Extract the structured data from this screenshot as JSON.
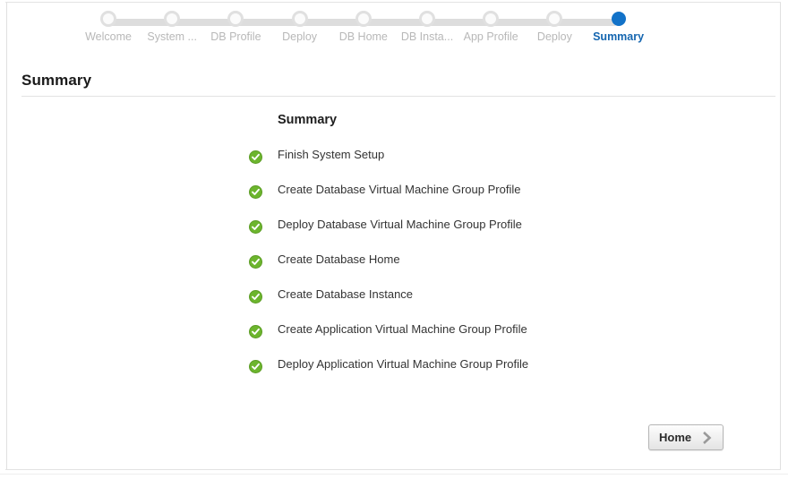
{
  "wizard": {
    "steps": [
      {
        "label": "Welcome",
        "state": "done"
      },
      {
        "label": "System ...",
        "state": "done"
      },
      {
        "label": "DB Profile",
        "state": "done"
      },
      {
        "label": "Deploy",
        "state": "done"
      },
      {
        "label": "DB Home",
        "state": "done"
      },
      {
        "label": "DB Insta...",
        "state": "done"
      },
      {
        "label": "App Profile",
        "state": "done"
      },
      {
        "label": "Deploy",
        "state": "done"
      },
      {
        "label": "Summary",
        "state": "active"
      }
    ],
    "active_color": "#1272c8",
    "inactive_color": "#b8b8b8",
    "track_color": "#dddddd"
  },
  "page": {
    "title": "Summary"
  },
  "summary": {
    "heading": "Summary",
    "check_color": "#6cb52d",
    "items": [
      {
        "label": "Finish System Setup",
        "icon": "check-circle-icon",
        "status": "complete"
      },
      {
        "label": "Create Database Virtual Machine Group Profile",
        "icon": "check-circle-icon",
        "status": "complete"
      },
      {
        "label": "Deploy Database Virtual Machine Group Profile",
        "icon": "check-circle-icon",
        "status": "complete"
      },
      {
        "label": "Create Database Home",
        "icon": "check-circle-icon",
        "status": "complete"
      },
      {
        "label": "Create Database Instance",
        "icon": "check-circle-icon",
        "status": "complete"
      },
      {
        "label": "Create Application Virtual Machine Group Profile",
        "icon": "check-circle-icon",
        "status": "complete"
      },
      {
        "label": "Deploy Application Virtual Machine Group Profile",
        "icon": "check-circle-icon",
        "status": "complete"
      }
    ]
  },
  "footer": {
    "home_button_label": "Home",
    "home_button_icon": "chevron-right-icon"
  }
}
